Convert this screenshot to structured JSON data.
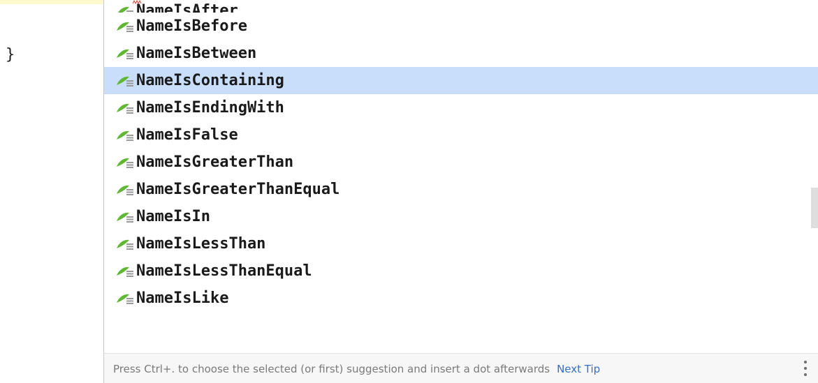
{
  "editor": {
    "closing_brace": "}"
  },
  "completion": {
    "partial_item_label": "NameIsAfter",
    "items": [
      {
        "label": "NameIsBefore",
        "icon": "spring-repository-method-icon",
        "selected": false
      },
      {
        "label": "NameIsBetween",
        "icon": "spring-repository-method-icon",
        "selected": false
      },
      {
        "label": "NameIsContaining",
        "icon": "spring-repository-method-icon",
        "selected": true
      },
      {
        "label": "NameIsEndingWith",
        "icon": "spring-repository-method-icon",
        "selected": false
      },
      {
        "label": "NameIsFalse",
        "icon": "spring-repository-method-icon",
        "selected": false
      },
      {
        "label": "NameIsGreaterThan",
        "icon": "spring-repository-method-icon",
        "selected": false
      },
      {
        "label": "NameIsGreaterThanEqual",
        "icon": "spring-repository-method-icon",
        "selected": false
      },
      {
        "label": "NameIsIn",
        "icon": "spring-repository-method-icon",
        "selected": false
      },
      {
        "label": "NameIsLessThan",
        "icon": "spring-repository-method-icon",
        "selected": false
      },
      {
        "label": "NameIsLessThanEqual",
        "icon": "spring-repository-method-icon",
        "selected": false
      },
      {
        "label": "NameIsLike",
        "icon": "spring-repository-method-icon",
        "selected": false
      }
    ],
    "footer": {
      "hint": "Press Ctrl+. to choose the selected (or first) suggestion and insert a dot afterwards",
      "next_tip": "Next Tip",
      "menu_icon": "more-vertical-icon"
    }
  },
  "colors": {
    "selection": "#c9defb",
    "icon_green": "#5fb832",
    "link_blue": "#2f6fd1"
  }
}
